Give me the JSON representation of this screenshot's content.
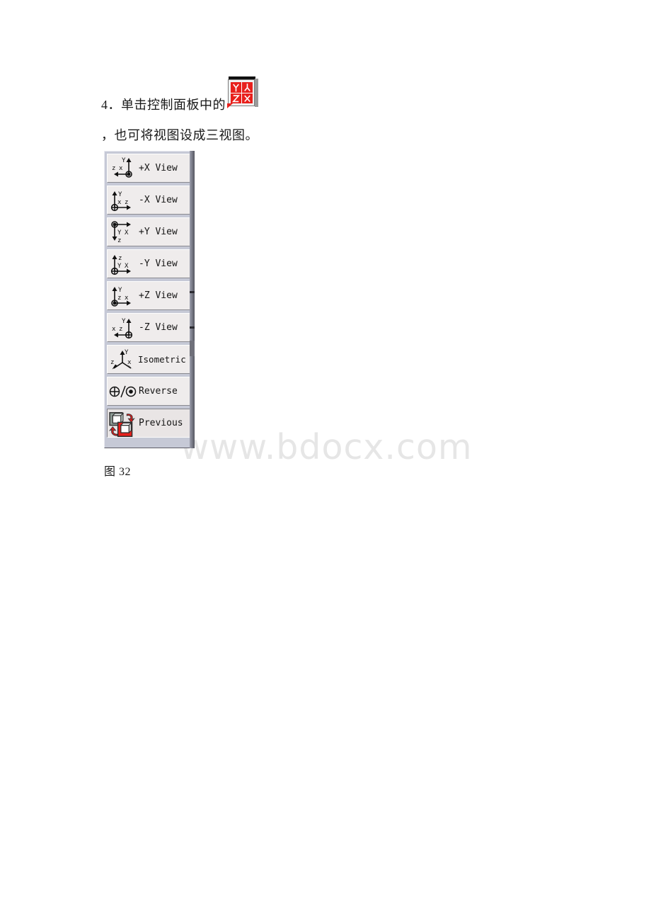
{
  "document": {
    "line1": "4．单击控制面板中的",
    "line2": "，也可将视图设成三视图。",
    "figure_caption": "图 32",
    "watermark": "www.bdocx.com"
  },
  "inline_control_icon": {
    "name": "three-view-control-icon",
    "cells": [
      "Y",
      "⊥",
      "Z",
      "X"
    ],
    "color": "#e8201c",
    "background": "#f1f1f1"
  },
  "view_panel": {
    "name": "view-orientation-panel",
    "background": "#c6c9d6",
    "button_face": "#efecec",
    "buttons": [
      {
        "label": "+X View",
        "axes": [
          "Y",
          "z",
          "x"
        ],
        "icon": "axis-plus-x"
      },
      {
        "label": "-X View",
        "axes": [
          "Y",
          "x",
          "z"
        ],
        "icon": "axis-minus-x"
      },
      {
        "label": "+Y View",
        "axes": [
          "Y",
          "X",
          "z"
        ],
        "icon": "axis-plus-y"
      },
      {
        "label": "-Y View",
        "axes": [
          "z",
          "Y",
          "X"
        ],
        "icon": "axis-minus-y"
      },
      {
        "label": "+Z View",
        "axes": [
          "Y",
          "z",
          "x"
        ],
        "icon": "axis-plus-z"
      },
      {
        "label": "-Z View",
        "axes": [
          "Y",
          "x",
          "z"
        ],
        "icon": "axis-minus-z"
      },
      {
        "label": "Isometric",
        "axes": [
          "Y",
          "z",
          "x"
        ],
        "icon": "axis-isometric"
      },
      {
        "label": "Reverse",
        "axes": [],
        "icon": "reverse-symbol"
      },
      {
        "label": "Previous",
        "axes": [],
        "icon": "previous-view-icon"
      }
    ]
  }
}
